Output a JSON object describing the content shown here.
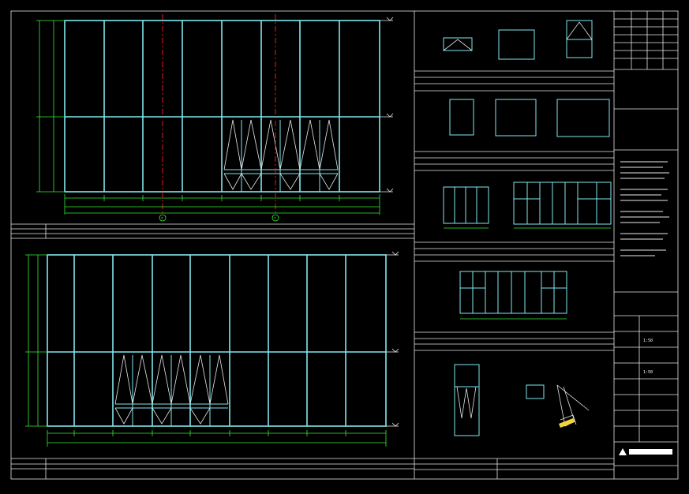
{
  "elevation_top": {
    "grid_left": "6",
    "grid_right": "5",
    "level_markers": [
      "",
      "",
      ""
    ],
    "dim_bottom": [
      "",
      "",
      "",
      "",
      "",
      "",
      "",
      ""
    ]
  },
  "elevation_bottom": {
    "level_markers": [
      "",
      "",
      ""
    ]
  },
  "scales": {
    "scale_a": "1:50",
    "scale_b": "1:50"
  },
  "colors": {
    "frame": "#e6e6e6",
    "window_frame": "#7fe8ef",
    "dimension": "#33ee33",
    "axis_line": "#ff2020"
  },
  "title_block": {
    "logo_icon": "triangle-logo-icon"
  }
}
